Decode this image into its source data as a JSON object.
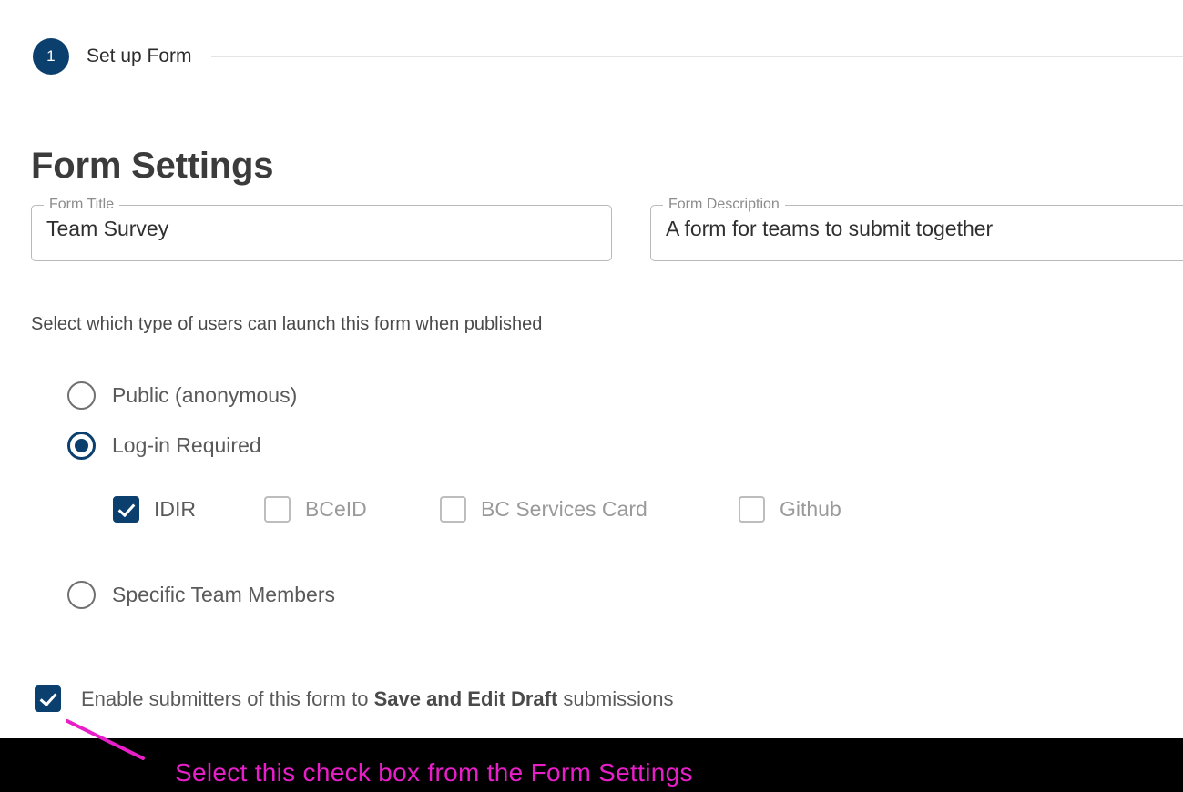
{
  "stepper": {
    "step_number": "1",
    "step_label": "Set up Form"
  },
  "page_title": "Form Settings",
  "fields": {
    "form_title": {
      "label": "Form Title",
      "value": "Team Survey"
    },
    "form_description": {
      "label": "Form Description",
      "value": "A form for teams to submit together"
    }
  },
  "access": {
    "instruction": "Select which type of users can launch this form when published",
    "options": [
      {
        "label": "Public (anonymous)",
        "selected": false
      },
      {
        "label": "Log-in Required",
        "selected": true
      },
      {
        "label": "Specific Team Members",
        "selected": false
      }
    ],
    "identity_providers": [
      {
        "label": "IDIR",
        "checked": true
      },
      {
        "label": "BCeID",
        "checked": false
      },
      {
        "label": "BC Services Card",
        "checked": false
      },
      {
        "label": "Github",
        "checked": false
      }
    ]
  },
  "draft_option": {
    "checked": true,
    "text_before": "Enable submitters of this form to ",
    "text_bold": "Save and Edit Draft",
    "text_after": " submissions"
  },
  "annotation": {
    "text": "Select this check box from the Form Settings",
    "color": "#e81fc9",
    "bar_color": "#000000"
  },
  "colors": {
    "brand_navy": "#0b3f6e",
    "body_text": "#5a5a5a",
    "field_border": "#b9b9b9"
  }
}
